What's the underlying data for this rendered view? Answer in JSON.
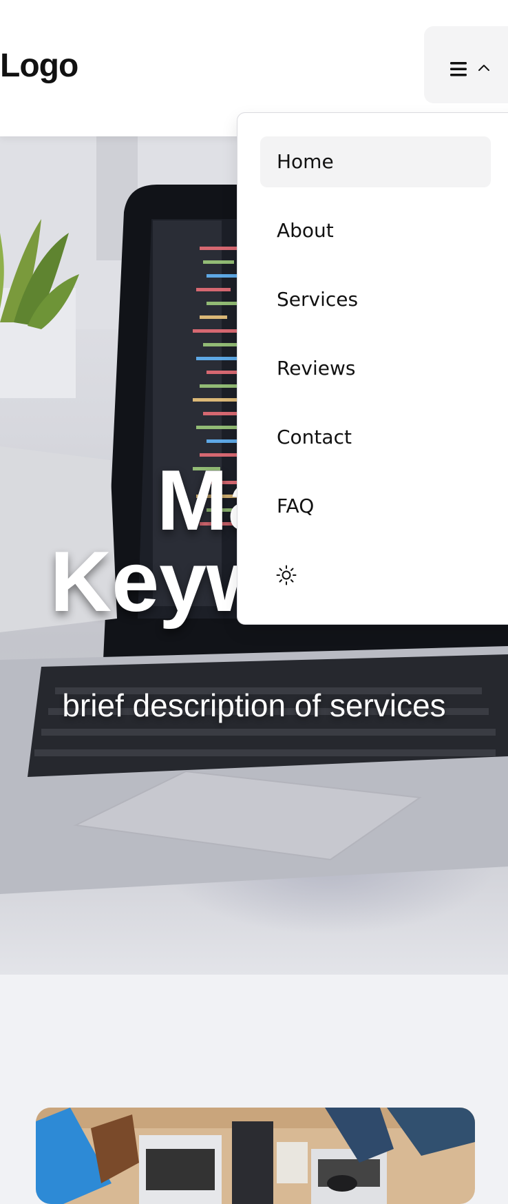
{
  "header": {
    "logo": "Logo",
    "menu_toggle": {
      "icon": "hamburger-icon",
      "state_icon": "chevron-up-icon"
    }
  },
  "nav": {
    "items": [
      {
        "label": "Home",
        "active": true
      },
      {
        "label": "About",
        "active": false
      },
      {
        "label": "Services",
        "active": false
      },
      {
        "label": "Reviews",
        "active": false
      },
      {
        "label": "Contact",
        "active": false
      },
      {
        "label": "FAQ",
        "active": false
      }
    ],
    "theme_toggle_icon": "sun-icon"
  },
  "hero": {
    "title_line1": "Main",
    "title_line2": "Keywords",
    "subtitle": "brief description of services"
  },
  "colors": {
    "page_bg": "#f1f2f5",
    "header_bg": "#ffffff",
    "text": "#111111",
    "active_item_bg": "#f3f3f4"
  }
}
